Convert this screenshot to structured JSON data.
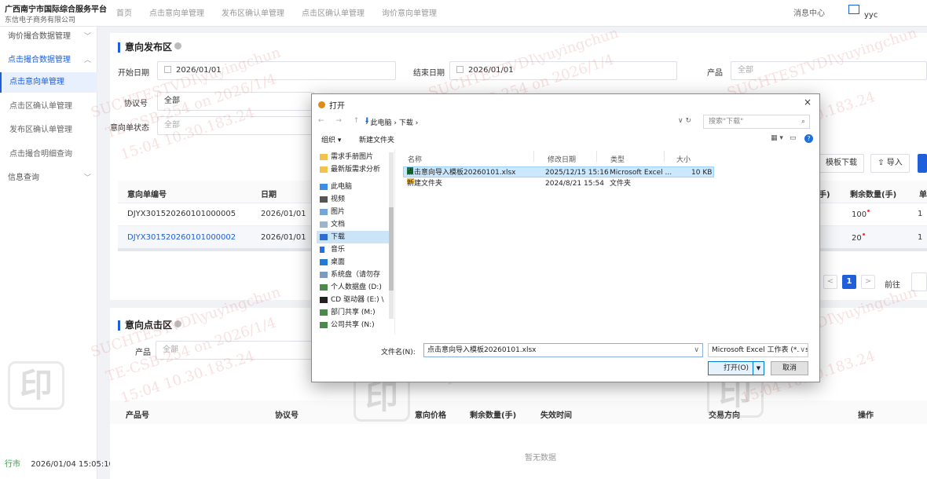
{
  "header": {
    "brand_line1": "广西南宁市国际综合服务平台",
    "brand_line2": "东信电子商务有限公司",
    "nav": [
      "首页",
      "点击意向单管理",
      "发布区确认单管理",
      "点击区确认单管理",
      "询价意向单管理"
    ],
    "message_center": "消息中心",
    "username": "yyc"
  },
  "sidebar": {
    "items": [
      {
        "label": "询价撮合数据管理",
        "arrow": "﹀"
      },
      {
        "label": "点击撮合数据管理",
        "arrow": "︿"
      },
      {
        "label": "点击意向单管理"
      },
      {
        "label": "点击区确认单管理"
      },
      {
        "label": "发布区确认单管理"
      },
      {
        "label": "点击撮合明细查询"
      },
      {
        "label": "信息查询",
        "arrow": "﹀"
      }
    ],
    "footer_prefix": "行市",
    "footer_time": "2026/01/04 15:05:10"
  },
  "publish": {
    "title": "意向发布区",
    "start_label": "开始日期",
    "start_value": "2026/01/01",
    "end_label": "结束日期",
    "end_value": "2026/01/01",
    "product_label": "产品",
    "product_placeholder": "全部",
    "agreement_label": "协议号",
    "agreement_value": "全部",
    "status_label": "意向单状态",
    "status_value": "全部",
    "btn_template": "模板下载",
    "btn_import": "导入",
    "table": {
      "col_id": "意向单编号",
      "col_date": "日期",
      "col_trade_tail": "手)",
      "col_remaining": "剩余数量(手)",
      "col_extra": "单",
      "rows": [
        {
          "id": "DJYX301520260101000005",
          "date": "2026/01/01",
          "remaining": "100",
          "extra": "1"
        },
        {
          "id": "DJYX301520260101000002",
          "date": "2026/01/01",
          "remaining": "20",
          "extra": "1"
        }
      ]
    },
    "pager": {
      "prev": "<",
      "current": "1",
      "next": ">",
      "goto": "前往"
    }
  },
  "click": {
    "title": "意向点击区",
    "product_label": "产品",
    "product_placeholder": "全部",
    "cols": [
      "产品号",
      "协议号",
      "意向价格",
      "剩余数量(手)",
      "失效时间",
      "交易方向",
      "操作"
    ],
    "empty": "暂无数据"
  },
  "watermark": {
    "line1": "SUCHTESTVDI\\yuyingchun",
    "line2": "TE-CSB-254 on 2026/1/4",
    "line3": "15:04 10.30.183.24",
    "seal": "印"
  },
  "dialog": {
    "title": "打开",
    "close": "×",
    "nav_buttons": "← → ↑",
    "path": [
      "此电脑",
      "下载"
    ],
    "search_placeholder": "搜索\"下载\"",
    "organize": "组织 ▾",
    "new_folder": "新建文件夹",
    "nav_items": [
      {
        "label": "需求手册图片",
        "icon": "folder"
      },
      {
        "label": "最新版需求分析",
        "icon": "folder"
      },
      {
        "label": "此电脑",
        "icon": "pc"
      },
      {
        "label": "视频",
        "icon": "video"
      },
      {
        "label": "图片",
        "icon": "picture"
      },
      {
        "label": "文档",
        "icon": "document"
      },
      {
        "label": "下载",
        "icon": "download"
      },
      {
        "label": "音乐",
        "icon": "music"
      },
      {
        "label": "桌面",
        "icon": "desktop"
      },
      {
        "label": "系统盘（请勿存",
        "icon": "drive"
      },
      {
        "label": "个人数据盘 (D:)",
        "icon": "drive"
      },
      {
        "label": "CD 驱动器 (E:) \\",
        "icon": "cd"
      },
      {
        "label": "部门共享 (M:)",
        "icon": "netdrive"
      },
      {
        "label": "公司共享 (N:)",
        "icon": "netdrive"
      }
    ],
    "columns": {
      "name": "名称",
      "modified": "修改日期",
      "type": "类型",
      "size": "大小"
    },
    "files": [
      {
        "name": "点击意向导入模板20260101.xlsx",
        "modified": "2025/12/15 15:16",
        "type": "Microsoft Excel ...",
        "size": "10 KB",
        "icon": "excel"
      },
      {
        "name": "新建文件夹",
        "modified": "2024/8/21 15:54",
        "type": "文件夹",
        "size": "",
        "icon": "folder"
      }
    ],
    "filename_label": "文件名(N):",
    "filename_value": "点击意向导入模板20260101.xlsx",
    "filetype": "Microsoft Excel 工作表 (*.xlsx",
    "open_btn": "打开(O)",
    "cancel_btn": "取消"
  }
}
